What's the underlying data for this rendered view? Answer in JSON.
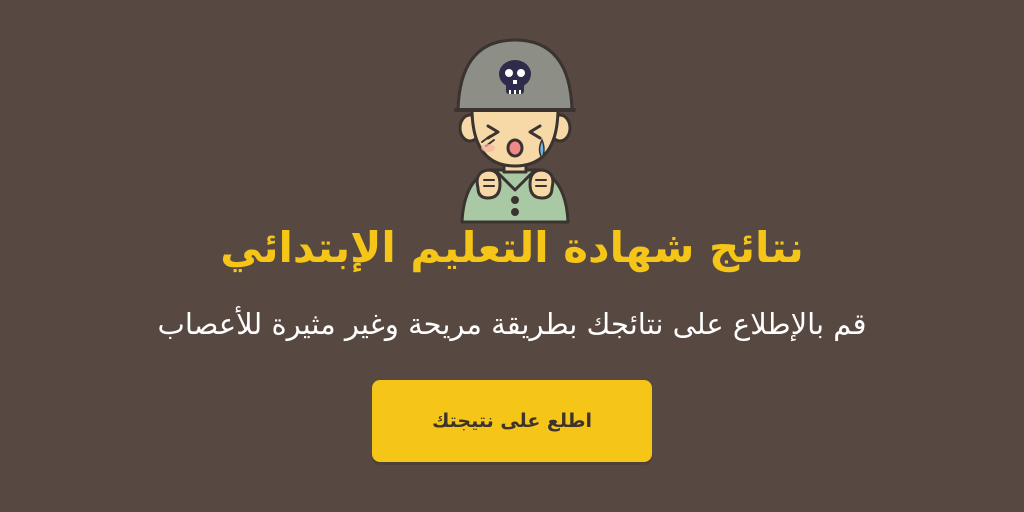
{
  "colors": {
    "background": "#574941",
    "accent": "#f5c518",
    "text_light": "#ffffff",
    "button_text": "#3e342e"
  },
  "mascot": {
    "icon": "crying-soldier-kid-icon",
    "helmet_emblem": "skull-icon"
  },
  "header": {
    "title": "نتائج شهادة التعليم الإبتدائي",
    "subtitle": "قم بالإطلاع على نتائجك بطريقة مريحة وغير مثيرة للأعصاب"
  },
  "cta": {
    "label": "اطلع على نتيجتك"
  }
}
